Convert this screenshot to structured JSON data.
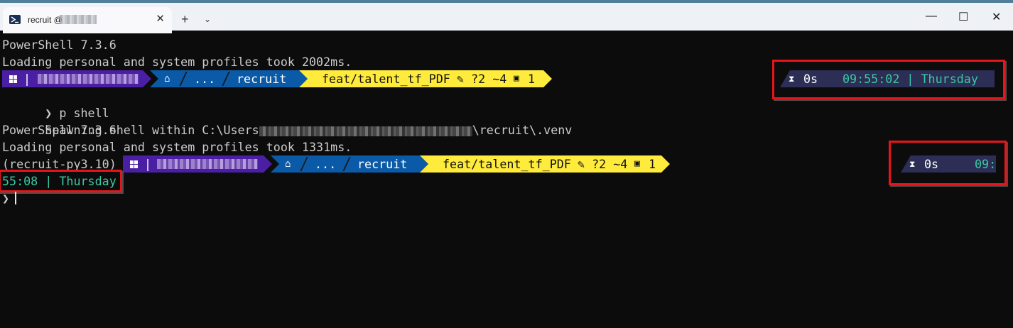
{
  "window": {
    "tab_title": "recruit @",
    "tab_close": "✕",
    "new_tab": "+",
    "tab_dropdown": "⌄",
    "minimize": "—",
    "maximize": "☐",
    "close": "✕"
  },
  "lines": {
    "l1": "PowerShell 7.3.6",
    "l2": "Loading personal and system profiles took 2002ms.",
    "l4_prompt": "❯",
    "l4_cmd": "p shell",
    "l5_prefix": "Spawning shell within C:\\Users",
    "l5_suffix": "\\recruit\\.venv",
    "l6": "PowerShell 7.3.6",
    "l7": "Loading personal and system profiles took 1331ms.",
    "l8_venv": "(recruit-py3.10)",
    "l9_wrap": "55:08 | Thursday",
    "l10_prompt": "❯"
  },
  "prompt1": {
    "user_sep": "|",
    "home_icon": "⌂",
    "path_ellipsis": "...",
    "path_dir": "recruit",
    "branch_icon": "",
    "branch": "feat/talent_tf_PDF",
    "git_status": "✎ ?2 ~4",
    "stash_icon": "▣",
    "stash_count": "1",
    "duration_icon": "⧗",
    "duration": "0s",
    "time": "09:55:02 | Thursday"
  },
  "prompt2": {
    "user_sep": "|",
    "home_icon": "⌂",
    "path_ellipsis": "...",
    "path_dir": "recruit",
    "branch": "feat/talent_tf_PDF",
    "git_status": "✎ ?2 ~4",
    "stash_icon": "▣",
    "stash_count": "1",
    "duration_icon": "⧗",
    "duration": "0s",
    "time_partial": "09:"
  },
  "colors": {
    "user_segment": "#4b1fa3",
    "path_segment": "#0b5aa7",
    "git_segment": "#ffeb3b",
    "time_segment": "#2c2e55",
    "time_text": "#3bc9a3",
    "highlight": "#e8141a"
  }
}
